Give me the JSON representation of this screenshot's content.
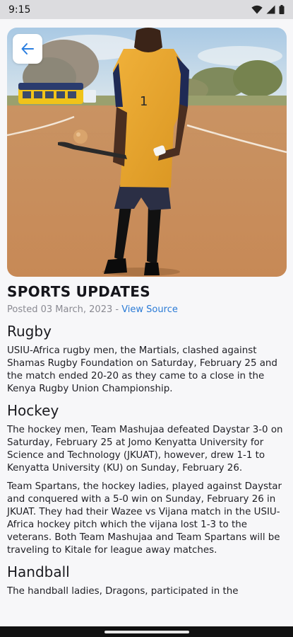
{
  "status_bar": {
    "time": "9:15"
  },
  "article": {
    "title": "SPORTS UPDATES",
    "posted": "Posted 03 March, 2023 - ",
    "view_source": "View Source",
    "sections": [
      {
        "heading": "Rugby",
        "paragraphs": [
          "USIU-Africa rugby men, the Martials, clashed against Shamas Rugby Foundation on Saturday, February 25 and the match ended 20-20 as they came to a close in the Kenya Rugby Union Championship."
        ]
      },
      {
        "heading": "Hockey",
        "paragraphs": [
          "The hockey men, Team Mashujaa defeated Daystar 3-0 on Saturday, February 25 at Jomo Kenyatta University for Science and Technology (JKUAT), however, drew 1-1 to Kenyatta University (KU) on Sunday, February 26.",
          "Team Spartans, the hockey ladies, played against Daystar and conquered with a 5-0 win on Sunday, February 26 in JKUAT. They had their Wazee vs Vijana match in the USIU-Africa hockey pitch which the vijana lost 1-3 to the veterans. Both Team Mashujaa and Team Spartans will be traveling to Kitale for league away matches."
        ]
      },
      {
        "heading": "Handball",
        "paragraphs": [
          "The handball ladies, Dragons, participated in the"
        ]
      }
    ]
  },
  "hero": {
    "jersey_number": "1"
  }
}
